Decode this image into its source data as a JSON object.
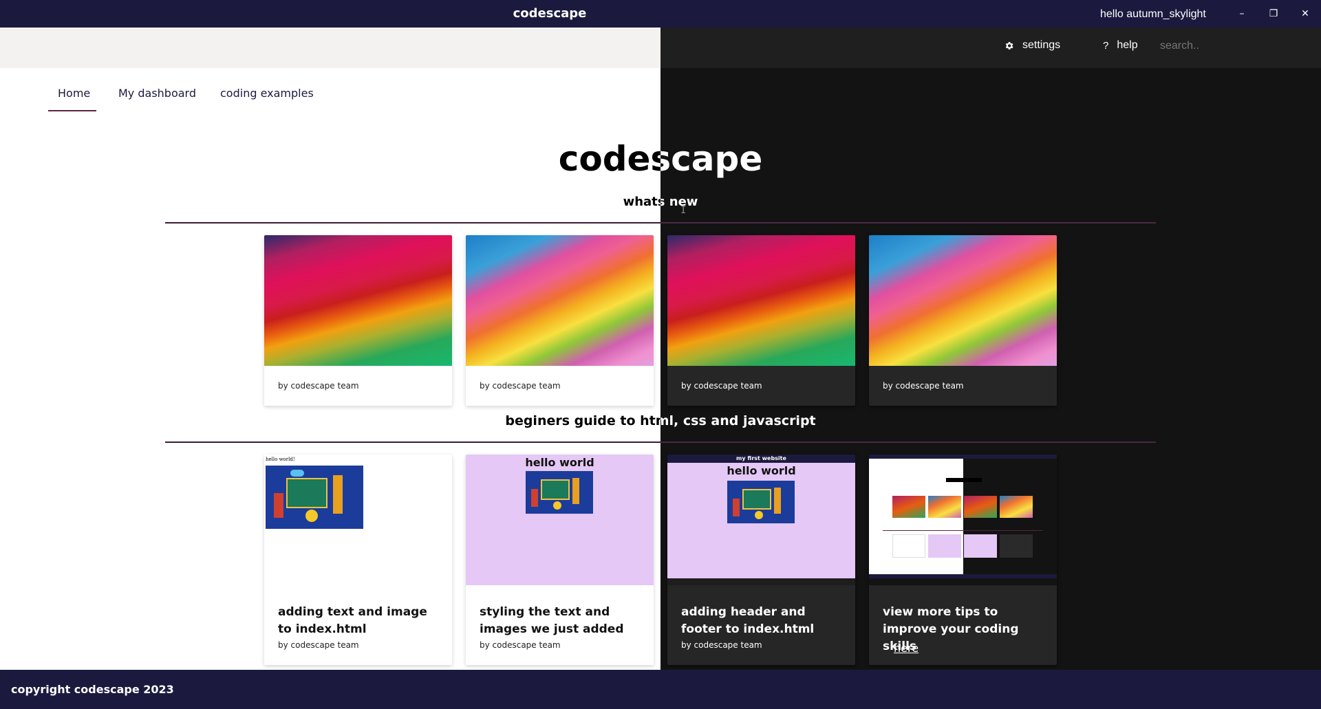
{
  "app": {
    "title": "codescape",
    "greeting": "hello autumn_skylight",
    "window_controls": {
      "minimize": "–",
      "maximize": "❐",
      "close": "✕"
    }
  },
  "toolbar": {
    "settings_label": "settings",
    "settings_icon": "gear-icon",
    "help_label": "help",
    "help_icon": "question-icon",
    "search_placeholder": "search.."
  },
  "nav": {
    "tabs": [
      {
        "label": "Home",
        "active": true
      },
      {
        "label": "My dashboard",
        "active": false
      },
      {
        "label": "coding examples",
        "active": false
      }
    ]
  },
  "main": {
    "heading": "codescape",
    "whats_new": "whats new",
    "beginners": "beginers guide to html, css and javascript"
  },
  "whats_new_cards": [
    {
      "author": "by codescape team"
    },
    {
      "author": "by codescape team"
    },
    {
      "author": "by codescape team"
    },
    {
      "author": "by codescape team"
    }
  ],
  "guide_cards": [
    {
      "title": "adding text and image to index.html",
      "author": "by codescape team",
      "thumb_caption": "hello world!"
    },
    {
      "title": "styling the text and images we just added",
      "author": "by codescape team",
      "thumb_caption": "hello world"
    },
    {
      "title": "adding header and footer to index.html",
      "author": "by codescape team",
      "thumb_header": "my first website",
      "thumb_caption": "hello world"
    },
    {
      "title": "view more tips to improve your coding skills",
      "link": "here"
    }
  ],
  "footer": {
    "copyright": "copyright codescape 2023"
  },
  "colors": {
    "titlebar": "#1b1a3e",
    "dark_bg": "#131313",
    "light_bg": "#ffffff",
    "accent": "#5a2340",
    "lavender": "#e5c8f5"
  }
}
